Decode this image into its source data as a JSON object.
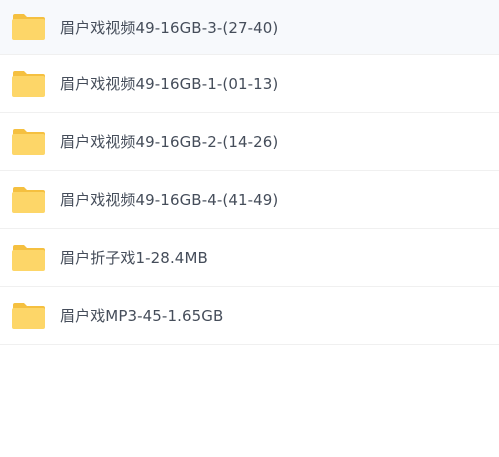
{
  "files": [
    {
      "name": "眉户戏视频49-16GB-3-(27-40)",
      "icon": "folder-icon"
    },
    {
      "name": "眉户戏视频49-16GB-1-(01-13)",
      "icon": "folder-icon"
    },
    {
      "name": "眉户戏视频49-16GB-2-(14-26)",
      "icon": "folder-icon"
    },
    {
      "name": "眉户戏视频49-16GB-4-(41-49)",
      "icon": "folder-icon"
    },
    {
      "name": "眉户折子戏1-28.4MB",
      "icon": "folder-icon"
    },
    {
      "name": "眉户戏MP3-45-1.65GB",
      "icon": "folder-icon"
    }
  ],
  "colors": {
    "folder_back": "#f5c040",
    "folder_front": "#fdd668",
    "text": "#454d5a",
    "divider": "#f0f0f0"
  }
}
